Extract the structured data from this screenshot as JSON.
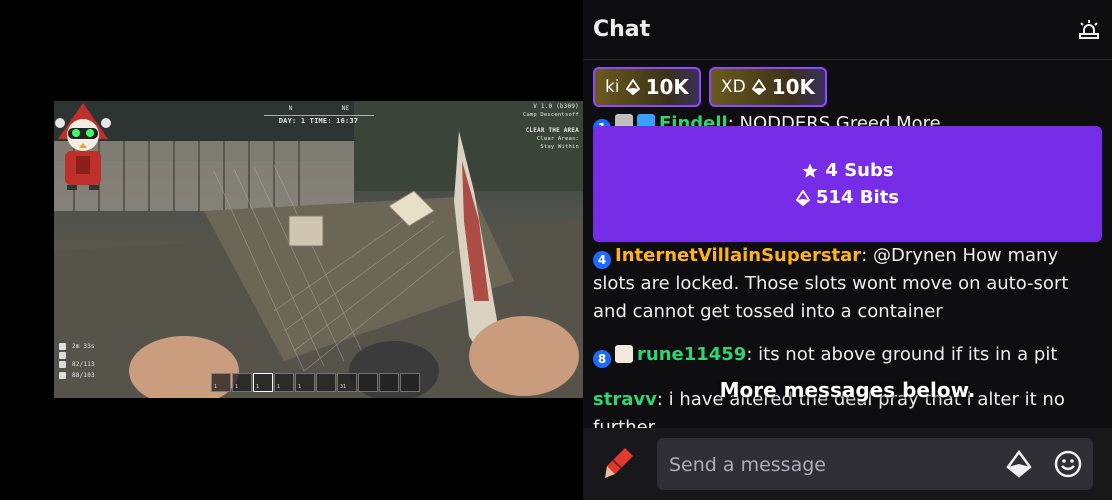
{
  "video": {
    "hud": {
      "compass_n": "N",
      "compass_ne": "NE",
      "day_time": "DAY: 1 TIME: 16:37",
      "version": "V 1.0 (b309)",
      "camp": "Camp Descentsoff",
      "quest_title": "CLEAR THE AREA",
      "quest_line1": "Clear Areas:",
      "quest_line2": "Stay Within",
      "stat_time": "2m 33s",
      "stat_food": "82/113",
      "stat_health": "88/103"
    },
    "hotbar": [
      "1",
      "1",
      "1",
      "1",
      "1",
      "",
      "31",
      "",
      "",
      ""
    ]
  },
  "chat": {
    "title": "Chat",
    "pinned": [
      {
        "prefix": "ki",
        "amount": "10K"
      },
      {
        "prefix": "XD",
        "amount": "10K"
      }
    ],
    "partial_message": {
      "badge": "1",
      "user": "Findell",
      "text": ": NODDERS Greed More"
    },
    "banner": {
      "subs": "4 Subs",
      "bits": "514 Bits"
    },
    "messages": [
      {
        "badge": "4",
        "user": "InternetVillainSuperstar",
        "user_color": "#ffb31a",
        "text": ": @Drynen How many slots are locked. Those slots wont move on auto-sort and cannot get tossed into a container"
      },
      {
        "badge": "8",
        "user": "rune11459",
        "user_color": "#2ed573",
        "text": ": its not above ground if its in a pit"
      },
      {
        "badge": "",
        "user": "stravv",
        "user_color": "#2ed573",
        "text": ": i have altered the deal pray that i alter it no further"
      }
    ],
    "more_messages": "More messages below.",
    "input_placeholder": "Send a message"
  },
  "colors": {
    "accent": "#9147ff",
    "banner": "#772ce8",
    "chat_bg": "#0e0e10"
  },
  "icons": {
    "header": "chat-settings-icon",
    "bits": "bits-icon",
    "emote": "emote-smiley-icon",
    "crayon": "crayon-icon"
  }
}
